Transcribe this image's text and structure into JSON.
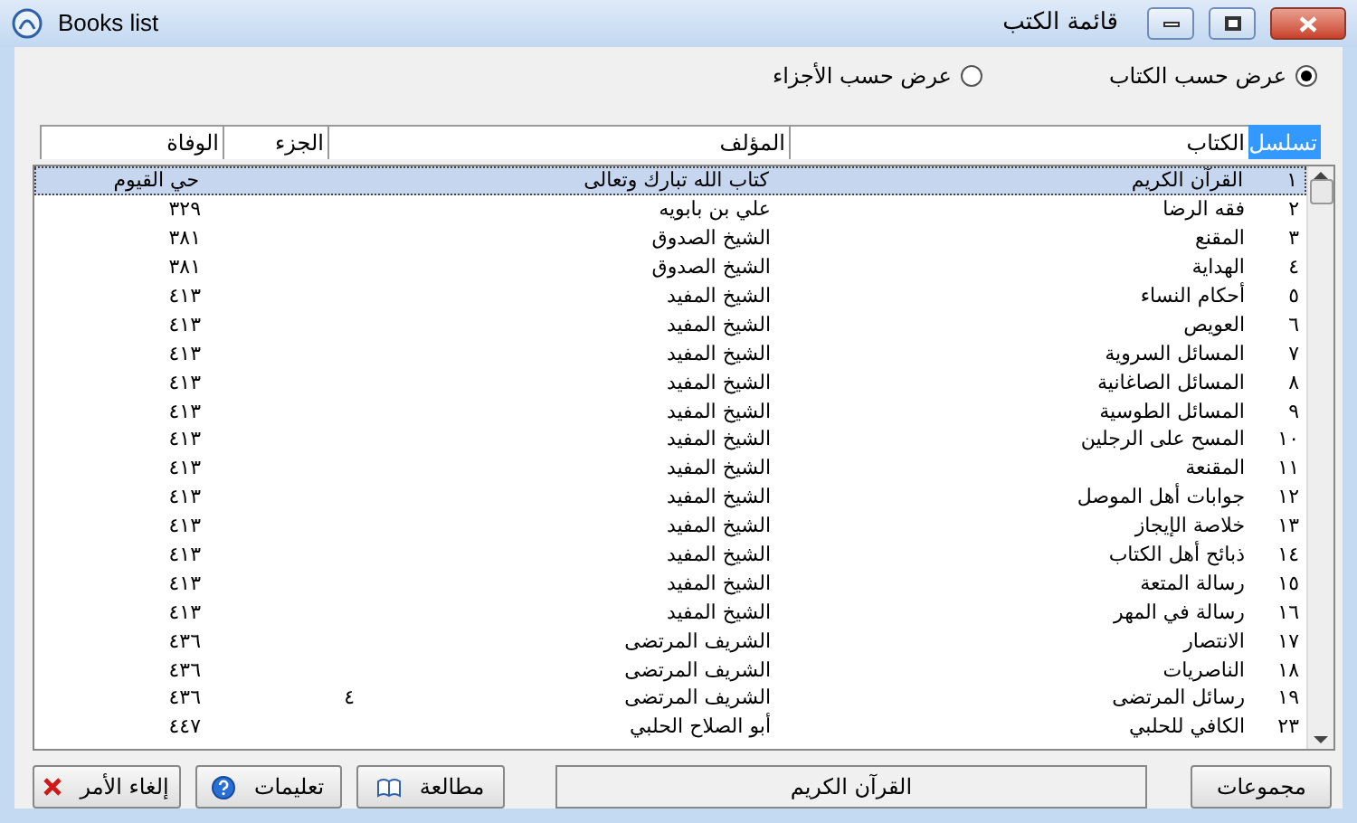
{
  "window": {
    "title": "Books list",
    "caption": "قائمة الكتب"
  },
  "view_options": [
    {
      "label": "عرض حسب الكتاب",
      "selected": true
    },
    {
      "label": "عرض حسب الأجزاء",
      "selected": false
    }
  ],
  "columns": [
    {
      "label": "تسلسل",
      "selected": true
    },
    {
      "label": "الكتاب",
      "selected": false
    },
    {
      "label": "المؤلف",
      "selected": false
    },
    {
      "label": "الجزء",
      "selected": false
    },
    {
      "label": "الوفاة",
      "selected": false
    }
  ],
  "rows": [
    {
      "number": "١",
      "book": "القرآن الكريم",
      "author": "كتاب الله تبارك وتعالى",
      "death": "حي القيوم",
      "selected": true
    },
    {
      "number": "٢",
      "book": "فقه الرضا",
      "author": "علي بن بابويه",
      "death": "٣٢٩",
      "selected": false
    },
    {
      "number": "٣",
      "book": "المقنع",
      "author": "الشيخ الصدوق",
      "death": "٣٨١",
      "selected": false
    },
    {
      "number": "٤",
      "book": "الهداية",
      "author": "الشيخ الصدوق",
      "death": "٣٨١",
      "selected": false
    },
    {
      "number": "٥",
      "book": "أحكام النساء",
      "author": "الشيخ المفيد",
      "death": "٤١٣",
      "selected": false
    },
    {
      "number": "٦",
      "book": "العويص",
      "author": "الشيخ المفيد",
      "death": "٤١٣",
      "selected": false
    },
    {
      "number": "٧",
      "book": "المسائل السروية",
      "author": "الشيخ المفيد",
      "death": "٤١٣",
      "selected": false
    },
    {
      "number": "٨",
      "book": "المسائل الصاغانية",
      "author": "الشيخ المفيد",
      "death": "٤١٣",
      "selected": false
    },
    {
      "number": "٩",
      "book": "المسائل الطوسية",
      "author": "الشيخ المفيد",
      "death": "٤١٣",
      "selected": false
    },
    {
      "number": "١٠",
      "book": "المسح على الرجلين",
      "author": "الشيخ المفيد",
      "death": "٤١٣",
      "selected": false
    },
    {
      "number": "١١",
      "book": "المقنعة",
      "author": "الشيخ المفيد",
      "death": "٤١٣",
      "selected": false
    },
    {
      "number": "١٢",
      "book": "جوابات أهل الموصل",
      "author": "الشيخ المفيد",
      "death": "٤١٣",
      "selected": false
    },
    {
      "number": "١٣",
      "book": "خلاصة الإيجاز",
      "author": "الشيخ المفيد",
      "death": "٤١٣",
      "selected": false
    },
    {
      "number": "١٤",
      "book": "ذبائح أهل الكتاب",
      "author": "الشيخ المفيد",
      "death": "٤١٣",
      "selected": false
    },
    {
      "number": "١٥",
      "book": "رسالة المتعة",
      "author": "الشيخ المفيد",
      "death": "٤١٣",
      "selected": false
    },
    {
      "number": "١٦",
      "book": "رسالة في المهر",
      "author": "الشيخ المفيد",
      "death": "٤١٣",
      "selected": false
    },
    {
      "number": "١٧",
      "book": "الانتصار",
      "author": "الشريف المرتضى",
      "death": "٤٣٦",
      "selected": false
    },
    {
      "number": "١٨",
      "book": "الناصريات",
      "author": "الشريف المرتضى",
      "death": "٤٣٦",
      "selected": false
    },
    {
      "number": "١٩",
      "book": "رسائل المرتضى",
      "author": "الشريف المرتضى",
      "part": "٤",
      "death": "٤٣٦",
      "selected": false
    },
    {
      "number": "٢٣",
      "book": "الكافي للحلبي",
      "author": "أبو الصلاح الحلبي",
      "death": "٤٤٧",
      "selected": false
    }
  ],
  "footer": {
    "groups_button": "مجموعات",
    "current_book": "القرآن الكريم",
    "buttons": [
      {
        "label": "مطالعة",
        "kind": "read"
      },
      {
        "label": "تعليمات",
        "kind": "help"
      },
      {
        "label": "إلغاء الأمر",
        "kind": "cancel"
      }
    ]
  }
}
